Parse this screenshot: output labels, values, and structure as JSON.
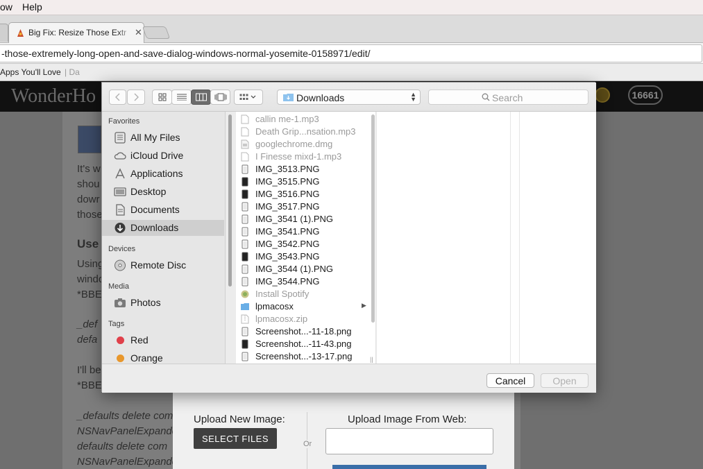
{
  "menubar": {
    "items": [
      "ow",
      "Help"
    ]
  },
  "tab": {
    "title": "Big Fix: Resize Those Extr",
    "close": "✕"
  },
  "address_bar": {
    "url": "-those-extremely-long-open-and-save-dialog-windows-normal-yosemite-0158971/edit/"
  },
  "bookmarks": {
    "item1": "Apps You'll Love",
    "separator": "| Da"
  },
  "site": {
    "logo": "WonderHo",
    "badge": "16661",
    "body_lines": [
      "It's w",
      "shou",
      "dowr",
      "those",
      "Use T",
      "Using",
      "windo",
      "*BBE",
      "_def",
      "defa",
      "I'll be",
      "*BBE",
      "_defaults delete com",
      "NSNavPanelExpande",
      "defaults delete com",
      "NSNavPanelExpande"
    ]
  },
  "upload": {
    "new_image_label": "Upload New Image:",
    "select_files": "SELECT FILES",
    "or": "Or",
    "from_web_label": "Upload Image From Web:"
  },
  "dialog": {
    "location": "Downloads",
    "search_placeholder": "Search",
    "sidebar": {
      "favorites_heading": "Favorites",
      "favorites": [
        {
          "label": "All My Files",
          "icon": "all-files-icon"
        },
        {
          "label": "iCloud Drive",
          "icon": "cloud-icon"
        },
        {
          "label": "Applications",
          "icon": "applications-icon"
        },
        {
          "label": "Desktop",
          "icon": "desktop-icon"
        },
        {
          "label": "Documents",
          "icon": "documents-icon"
        },
        {
          "label": "Downloads",
          "icon": "downloads-icon",
          "selected": true
        }
      ],
      "devices_heading": "Devices",
      "devices": [
        {
          "label": "Remote Disc",
          "icon": "disc-icon"
        }
      ],
      "media_heading": "Media",
      "media": [
        {
          "label": "Photos",
          "icon": "camera-icon"
        }
      ],
      "tags_heading": "Tags",
      "tags": [
        {
          "label": "Red",
          "color": "#e0404a"
        },
        {
          "label": "Orange",
          "color": "#e8972c"
        }
      ]
    },
    "files": [
      {
        "name": "callin me-1.mp3",
        "dim": true,
        "kind": "audio"
      },
      {
        "name": "Death Grip...nsation.mp3",
        "dim": true,
        "kind": "audio"
      },
      {
        "name": "googlechrome.dmg",
        "dim": true,
        "kind": "disk"
      },
      {
        "name": "I Finesse mixd-1.mp3",
        "dim": true,
        "kind": "audio"
      },
      {
        "name": "IMG_3513.PNG",
        "dim": false,
        "kind": "image"
      },
      {
        "name": "IMG_3515.PNG",
        "dim": false,
        "kind": "image-dark"
      },
      {
        "name": "IMG_3516.PNG",
        "dim": false,
        "kind": "image-dark"
      },
      {
        "name": "IMG_3517.PNG",
        "dim": false,
        "kind": "image"
      },
      {
        "name": "IMG_3541 (1).PNG",
        "dim": false,
        "kind": "image"
      },
      {
        "name": "IMG_3541.PNG",
        "dim": false,
        "kind": "image"
      },
      {
        "name": "IMG_3542.PNG",
        "dim": false,
        "kind": "image"
      },
      {
        "name": "IMG_3543.PNG",
        "dim": false,
        "kind": "image-dark"
      },
      {
        "name": "IMG_3544 (1).PNG",
        "dim": false,
        "kind": "image"
      },
      {
        "name": "IMG_3544.PNG",
        "dim": false,
        "kind": "image"
      },
      {
        "name": "Install Spotify",
        "dim": true,
        "kind": "app"
      },
      {
        "name": "lpmacosx",
        "dim": false,
        "kind": "folder"
      },
      {
        "name": "lpmacosx.zip",
        "dim": true,
        "kind": "zip"
      },
      {
        "name": "Screenshot...-11-18.png",
        "dim": false,
        "kind": "image"
      },
      {
        "name": "Screenshot...-11-43.png",
        "dim": false,
        "kind": "image-dark"
      },
      {
        "name": "Screenshot...-13-17.png",
        "dim": false,
        "kind": "image"
      }
    ],
    "cancel_label": "Cancel",
    "open_label": "Open"
  }
}
